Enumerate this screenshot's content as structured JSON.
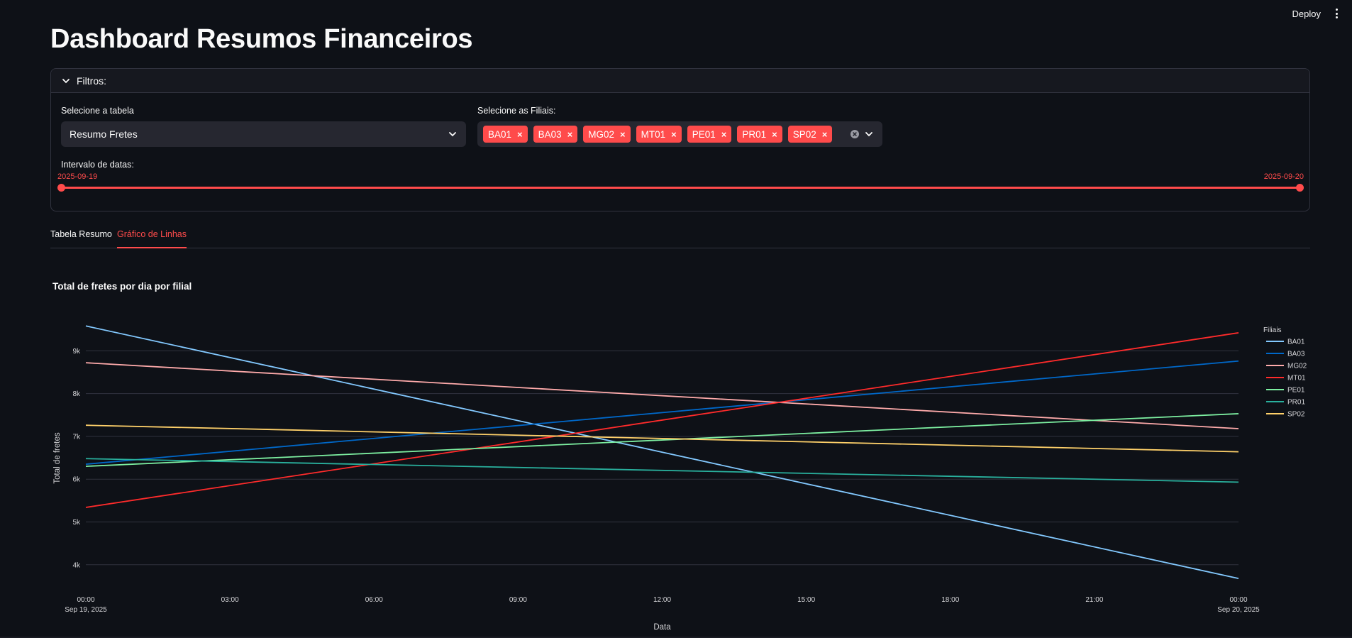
{
  "header": {
    "deploy_label": "Deploy"
  },
  "page": {
    "title": "Dashboard Resumos Financeiros"
  },
  "filters": {
    "expander_label": "Filtros:",
    "table_select": {
      "label": "Selecione a tabela",
      "value": "Resumo Fretes"
    },
    "branches_select": {
      "label": "Selecione as Filiais:",
      "selected": [
        "BA01",
        "BA03",
        "MG02",
        "MT01",
        "PE01",
        "PR01",
        "SP02"
      ],
      "remove_glyph": "×"
    },
    "date_range": {
      "label": "Intervalo de datas:",
      "start": "2025-09-19",
      "end": "2025-09-20",
      "start_fraction": 0,
      "end_fraction": 1
    }
  },
  "tabs": [
    {
      "label": "Tabela Resumo",
      "active": false
    },
    {
      "label": "Gráfico de Linhas",
      "active": true
    }
  ],
  "chart_data": {
    "type": "line",
    "title": "Total de fretes por dia por filial",
    "xlabel": "Data",
    "ylabel": "Total de fretes",
    "legend_title": "Filiais",
    "legend_position": "right",
    "grid": true,
    "x_ticks": [
      {
        "hours": 0,
        "label": "00:00",
        "sublabel": "Sep 19, 2025"
      },
      {
        "hours": 3,
        "label": "03:00",
        "sublabel": ""
      },
      {
        "hours": 6,
        "label": "06:00",
        "sublabel": ""
      },
      {
        "hours": 9,
        "label": "09:00",
        "sublabel": ""
      },
      {
        "hours": 12,
        "label": "12:00",
        "sublabel": ""
      },
      {
        "hours": 15,
        "label": "15:00",
        "sublabel": ""
      },
      {
        "hours": 18,
        "label": "18:00",
        "sublabel": ""
      },
      {
        "hours": 21,
        "label": "21:00",
        "sublabel": ""
      },
      {
        "hours": 24,
        "label": "00:00",
        "sublabel": "Sep 20, 2025"
      }
    ],
    "x": [
      "2025-09-19",
      "2025-09-20"
    ],
    "xlim": [
      0,
      24
    ],
    "y_ticks": [
      {
        "value": 4000,
        "label": "4k"
      },
      {
        "value": 5000,
        "label": "5k"
      },
      {
        "value": 6000,
        "label": "6k"
      },
      {
        "value": 7000,
        "label": "7k"
      },
      {
        "value": 8000,
        "label": "8k"
      },
      {
        "value": 9000,
        "label": "9k"
      }
    ],
    "ylim": [
      3350,
      9900
    ],
    "series": [
      {
        "name": "BA01",
        "color": "#83c9ff",
        "values": [
          9580,
          3680
        ]
      },
      {
        "name": "BA03",
        "color": "#0068c9",
        "values": [
          6350,
          8760
        ]
      },
      {
        "name": "MG02",
        "color": "#ffabab",
        "values": [
          8720,
          7180
        ]
      },
      {
        "name": "MT01",
        "color": "#ff2b2b",
        "values": [
          5340,
          9420
        ]
      },
      {
        "name": "PE01",
        "color": "#7defa1",
        "values": [
          6300,
          7530
        ]
      },
      {
        "name": "PR01",
        "color": "#29b09d",
        "values": [
          6480,
          5930
        ]
      },
      {
        "name": "SP02",
        "color": "#ffd16a",
        "values": [
          7260,
          6640
        ]
      }
    ]
  }
}
